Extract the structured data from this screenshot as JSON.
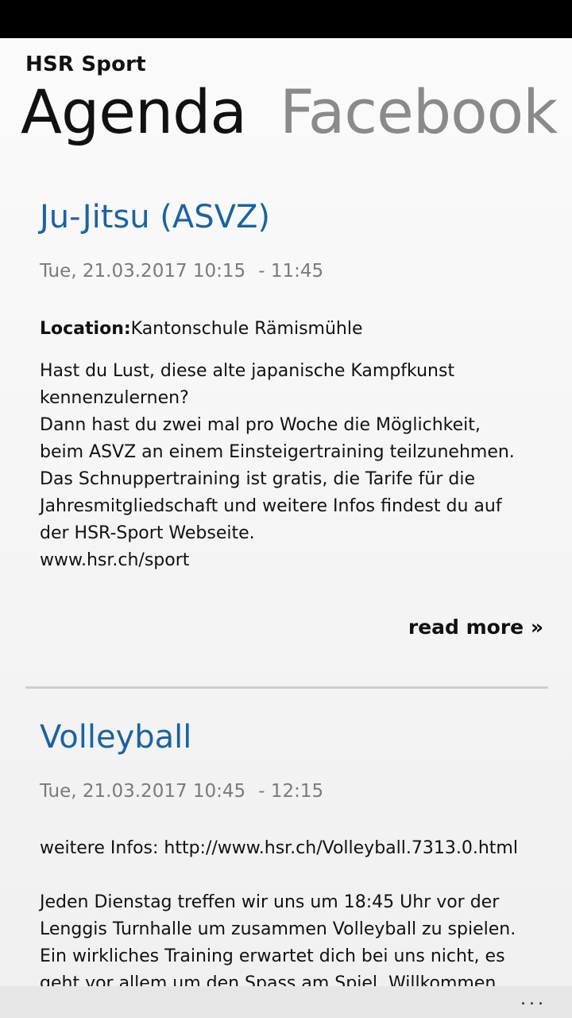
{
  "app": {
    "title": "HSR Sport"
  },
  "pivot": {
    "tabs": [
      {
        "label": "Agenda",
        "active": true
      },
      {
        "label": "Facebook",
        "active": false
      }
    ]
  },
  "events": [
    {
      "title": "Ju-Jitsu (ASVZ)",
      "date": "Tue, 21.03.2017 10:15",
      "end_time": "- 11:45",
      "location_label": "Location:",
      "location": "Kantonschule Rämismühle",
      "description": "Hast du Lust, diese alte japanische Kampfkunst\nkennenzulernen?\nDann hast du zwei mal pro Woche die Möglichkeit,\nbeim ASVZ an einem Einsteigertraining teilzunehmen.\nDas Schnuppertraining ist gratis, die Tarife für die\nJahresmitgliedschaft und weitere Infos findest du auf\nder HSR-Sport Webseite.\nwww.hsr.ch/sport",
      "read_more": "read more »"
    },
    {
      "title": "Volleyball",
      "date": "Tue, 21.03.2017 10:45",
      "end_time": "- 12:15",
      "description": "weitere Infos: http://www.hsr.ch/Volleyball.7313.0.html\n\nJeden Dienstag treffen wir uns um 18:45 Uhr vor der\nLenggis Turnhalle um zusammen Volleyball zu spielen.\nEin wirkliches Training erwartet dich bei uns nicht, es\ngeht vor allem um den Spass am Spiel. Willkommen"
    }
  ],
  "app_bar": {
    "more_label": "..."
  }
}
